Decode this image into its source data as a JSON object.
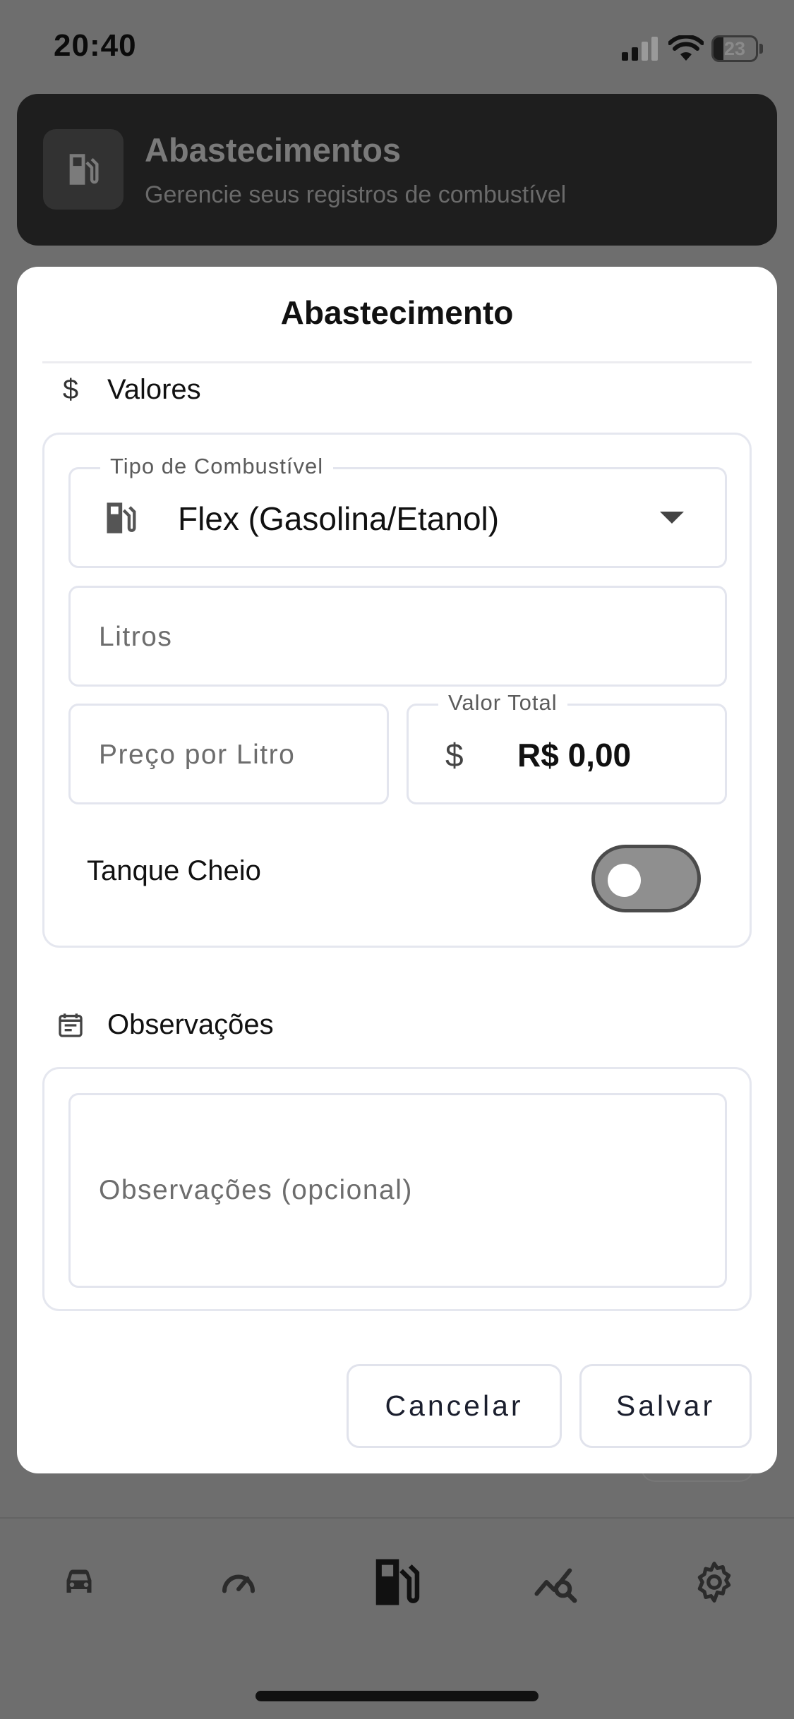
{
  "status_bar": {
    "time": "20:40",
    "battery": "23"
  },
  "header": {
    "title": "Abastecimentos",
    "subtitle": "Gerencie seus registros de combustível",
    "icon": "fuel-pump-icon"
  },
  "dialog": {
    "title": "Abastecimento",
    "values_section": {
      "label": "Valores",
      "icon": "dollar-icon",
      "fuel_type": {
        "label": "Tipo de Combustível",
        "value": "Flex (Gasolina/Etanol)",
        "icon": "fuel-pump-icon"
      },
      "liters": {
        "placeholder": "Litros"
      },
      "price_per_liter": {
        "placeholder": "Preço por Litro"
      },
      "total": {
        "label": "Valor Total",
        "prefix": "$",
        "value": "R$ 0,00"
      },
      "full_tank": {
        "label": "Tanque Cheio",
        "on": false
      }
    },
    "notes_section": {
      "label": "Observações",
      "icon": "notes-icon",
      "placeholder": "Observações (opcional)"
    },
    "cancel_label": "Cancelar",
    "save_label": "Salvar"
  },
  "bottom_nav": {
    "items": [
      {
        "icon": "car-icon",
        "active": false
      },
      {
        "icon": "speedometer-icon",
        "active": false
      },
      {
        "icon": "fuel-pump-icon",
        "active": true
      },
      {
        "icon": "chart-search-icon",
        "active": false
      },
      {
        "icon": "gear-icon",
        "active": false
      }
    ]
  },
  "colors": {
    "scrim": "#6e6e6e",
    "dialog_bg": "#ffffff",
    "field_border": "#e3e5ee",
    "toggle_off": "#8f8f8f"
  }
}
